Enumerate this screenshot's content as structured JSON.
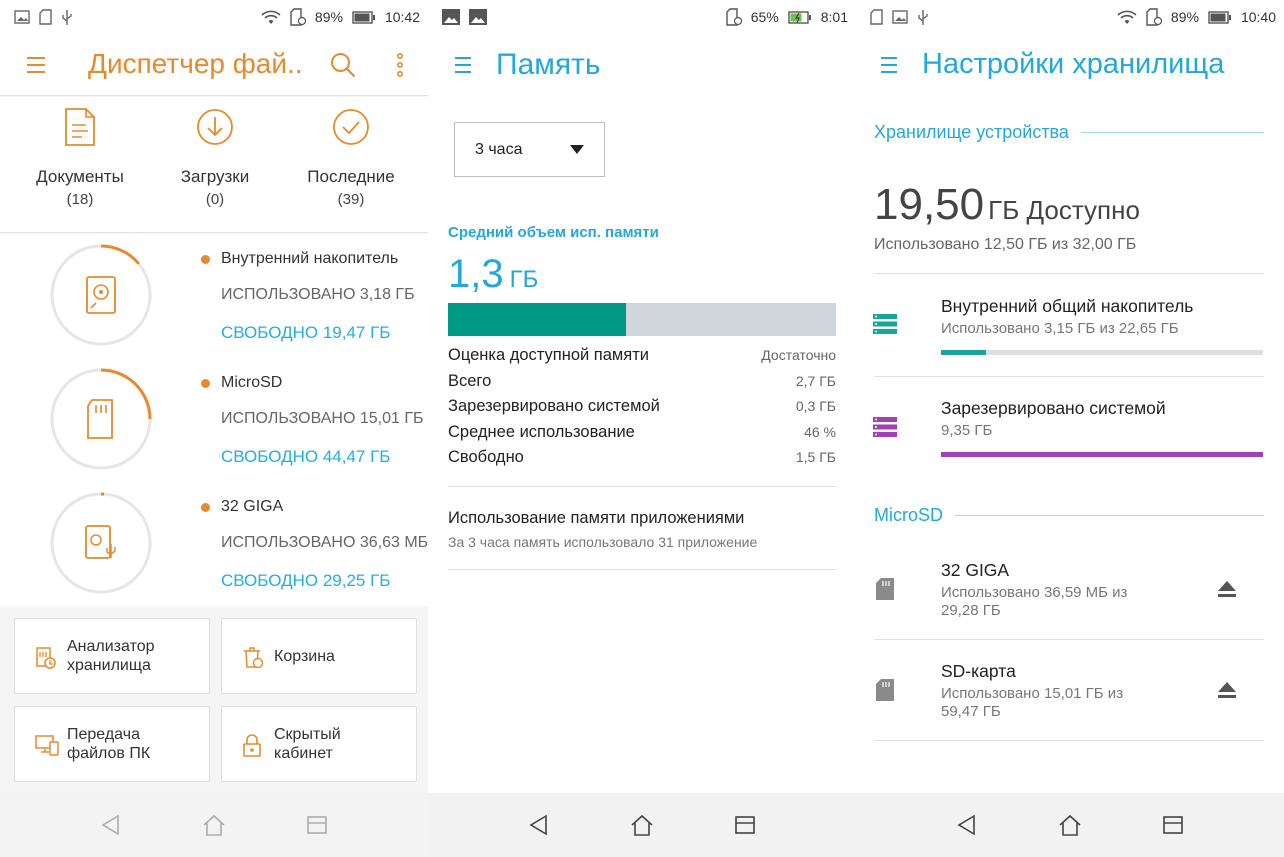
{
  "colors": {
    "orange": "#e8892b",
    "blue": "#22a8dc",
    "teal": "#009a87",
    "purple": "#a43fb8"
  },
  "screen1": {
    "status": {
      "battery": "89%",
      "time": "10:42",
      "icons": [
        "image-icon",
        "sd-card-icon",
        "usb-icon",
        "wifi-icon",
        "battery-icon"
      ]
    },
    "title": "Диспетчер фай...",
    "shortcuts": [
      {
        "label": "Документы",
        "count": "(18)",
        "icon": "document-icon"
      },
      {
        "label": "Загрузки",
        "count": "(0)",
        "icon": "download-icon"
      },
      {
        "label": "Последние",
        "count": "(39)",
        "icon": "recent-check-icon"
      }
    ],
    "storages": [
      {
        "name": "Внутренний накопитель",
        "used": "ИСПОЛЬЗОВАНО 3,18 ГБ",
        "free": "СВОБОДНО 19,47 ГБ",
        "fraction": 0.14,
        "icon": "internal-drive-icon"
      },
      {
        "name": "MicroSD",
        "used": "ИСПОЛЬЗОВАНО 15,01 ГБ",
        "free": "СВОБОДНО 44,47 ГБ",
        "fraction": 0.25,
        "icon": "microsd-icon"
      },
      {
        "name": "32 GIGA",
        "used": "ИСПОЛЬЗОВАНО 36,63 МБ",
        "free": "СВОБОДНО 29,25 ГБ",
        "fraction": 0.01,
        "icon": "usb-drive-icon"
      }
    ],
    "tools": [
      {
        "label": "Анализатор хранилища",
        "icon": "storage-analyzer-icon"
      },
      {
        "label": "Корзина",
        "icon": "trash-icon"
      },
      {
        "label": "Передача файлов ПК",
        "icon": "pc-transfer-icon"
      },
      {
        "label": "Скрытый кабинет",
        "icon": "lock-icon"
      }
    ]
  },
  "screen2": {
    "status": {
      "battery": "65%",
      "time": "8:01"
    },
    "title": "Память",
    "period": "3 часа",
    "section_label": "Средний объем исп. памяти",
    "avg_value": "1,3",
    "avg_unit": "ГБ",
    "usage_fraction": 0.46,
    "stats": [
      {
        "key": "Оценка доступной памяти",
        "value": "Достаточно"
      },
      {
        "key": "Всего",
        "value": "2,7 ГБ"
      },
      {
        "key": "Зарезервировано системой",
        "value": "0,3 ГБ"
      },
      {
        "key": "Среднее использование",
        "value": "46 %"
      },
      {
        "key": "Свободно",
        "value": "1,5 ГБ"
      }
    ],
    "apps_title": "Использование памяти приложениями",
    "apps_desc": "За 3 часа память использовало 31 приложение"
  },
  "screen3": {
    "status": {
      "battery": "89%",
      "time": "10:40"
    },
    "title": "Настройки хранилища",
    "device_header": "Хранилище устройства",
    "available_value": "19,50",
    "available_unit": "ГБ Доступно",
    "used_total": "Использовано 12,50 ГБ из 32,00 ГБ",
    "internal": {
      "name": "Внутренний общий накопитель",
      "sub": "Использовано 3,15 ГБ из 22,65 ГБ",
      "fraction": 0.14
    },
    "system": {
      "name": "Зарезервировано системой",
      "sub": "9,35 ГБ",
      "fraction": 1.0
    },
    "microsd_header": "MicroSD",
    "sd_items": [
      {
        "name": "32 GIGA",
        "sub1": "Использовано 36,59 МБ из",
        "sub2": "29,28 ГБ"
      },
      {
        "name": "SD-карта",
        "sub1": "Использовано 15,01 ГБ из",
        "sub2": "59,47 ГБ"
      }
    ]
  }
}
